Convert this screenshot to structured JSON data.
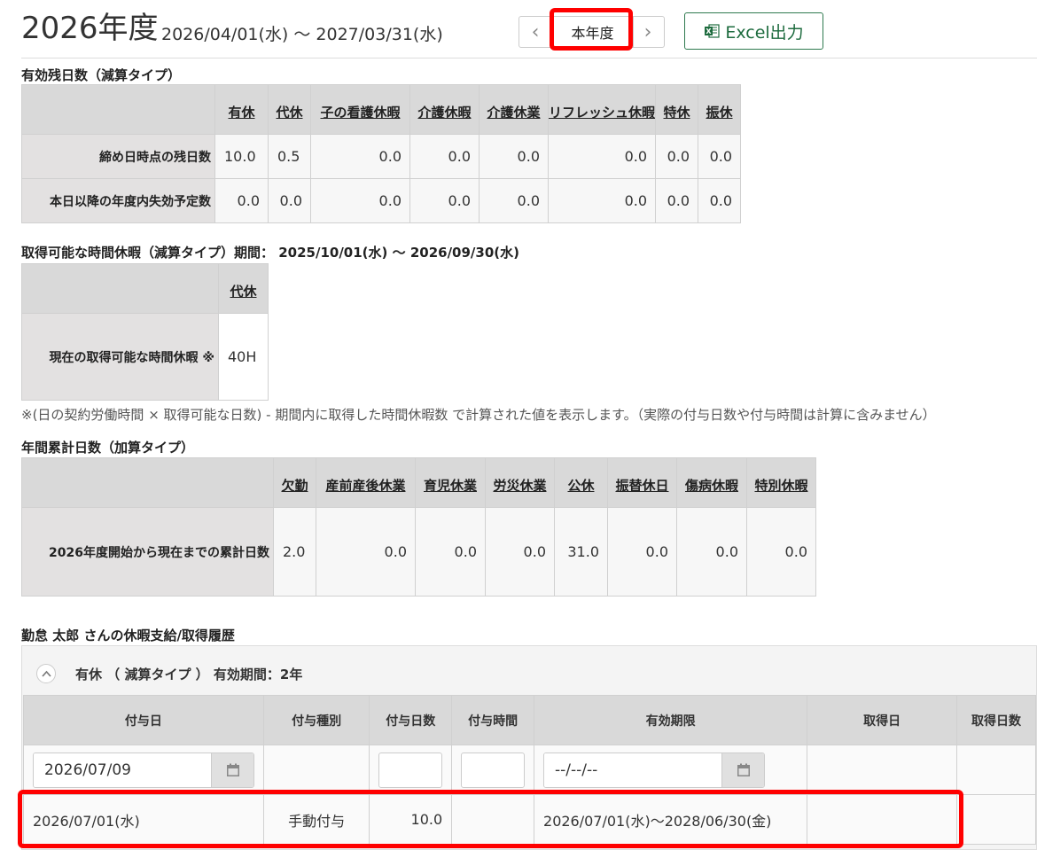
{
  "header": {
    "fiscal_year": "2026年度",
    "date_range": "2026/04/01(水) ～ 2027/03/31(水)",
    "prev_label": "‹",
    "current_label": "本年度",
    "next_label": "›",
    "excel_label": "Excel出力"
  },
  "remaining": {
    "title": "有効残日数（減算タイプ）",
    "columns": [
      "有休",
      "代休",
      "子の看護休暇",
      "介護休暇",
      "介護休業",
      "リフレッシュ休暇",
      "特休",
      "振休"
    ],
    "rows": [
      {
        "label": "締め日時点の残日数",
        "values": [
          "10.0",
          "0.5",
          "0.0",
          "0.0",
          "0.0",
          "0.0",
          "0.0",
          "0.0"
        ]
      },
      {
        "label": "本日以降の年度内失効予定数",
        "values": [
          "0.0",
          "0.0",
          "0.0",
          "0.0",
          "0.0",
          "0.0",
          "0.0",
          "0.0"
        ]
      }
    ]
  },
  "hourly": {
    "title": "取得可能な時間休暇（減算タイプ）期間： 2025/10/01(水) ～ 2026/09/30(水)",
    "column": "代休",
    "row_label": "現在の取得可能な時間休暇 ※",
    "value": "40H",
    "note": "※(日の契約労働時間 × 取得可能な日数) - 期間内に取得した時間休暇数 で計算された値を表示します。（実際の付与日数や付与時間は計算に含みません）"
  },
  "annual": {
    "title": "年間累計日数（加算タイプ）",
    "columns": [
      "欠勤",
      "産前産後休業",
      "育児休業",
      "労災休業",
      "公休",
      "振替休日",
      "傷病休暇",
      "特別休暇"
    ],
    "row_label": "2026年度開始から現在までの累計日数",
    "values": [
      "2.0",
      "0.0",
      "0.0",
      "0.0",
      "31.0",
      "0.0",
      "0.0",
      "0.0"
    ]
  },
  "history": {
    "title": "勤怠 太郎 さんの休暇支給/取得履歴",
    "panel_title": "有休 （ 減算タイプ ） 有効期間：2年",
    "columns": [
      "付与日",
      "付与種別",
      "付与日数",
      "付与時間",
      "有効期限",
      "取得日",
      "取得日数"
    ],
    "input_date_value": "2026/07/09",
    "input_expiry_placeholder": "--/--/--",
    "row": {
      "grant_date": "2026/07/01(水)",
      "grant_type": "手動付与",
      "grant_days": "10.0",
      "grant_hours": "",
      "expiry": "2026/07/01(水)～2028/06/30(金)",
      "taken_date": "",
      "taken_days": ""
    }
  },
  "colors": {
    "accent_green": "#1d6b3e",
    "highlight": "#ff0000"
  }
}
